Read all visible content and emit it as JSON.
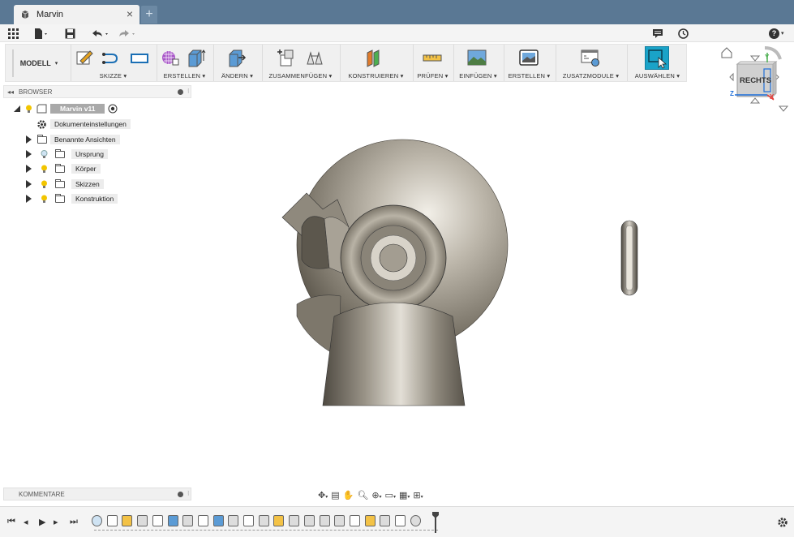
{
  "window": {
    "tab_title": "Marvin",
    "tab_close": "×",
    "new_tab": "+"
  },
  "quick_access": {
    "help": "?"
  },
  "ribbon": {
    "workspace": "MODELL",
    "groups": [
      {
        "name": "SKIZZE",
        "label": "SKIZZE ▾"
      },
      {
        "name": "ERSTELLEN",
        "label": "ERSTELLEN ▾"
      },
      {
        "name": "AENDERN",
        "label": "ÄNDERN ▾"
      },
      {
        "name": "ZUSAMMENFUEGEN",
        "label": "ZUSAMMENFÜGEN ▾"
      },
      {
        "name": "KONSTRUIEREN",
        "label": "KONSTRUIEREN ▾"
      },
      {
        "name": "PRUEFEN",
        "label": "PRÜFEN ▾"
      },
      {
        "name": "EINFUEGEN",
        "label": "EINFÜGEN ▾"
      },
      {
        "name": "ERSTELLEN2",
        "label": "ERSTELLEN ▾"
      },
      {
        "name": "ZUSATZMODULE",
        "label": "ZUSATZMODULE ▾"
      },
      {
        "name": "AUSWAEHLEN",
        "label": "AUSWÄHLEN ▾"
      }
    ]
  },
  "browser": {
    "title": "BROWSER",
    "root": "Marvin v11",
    "items": [
      {
        "label": "Dokumenteinstellungen"
      },
      {
        "label": "Benannte Ansichten"
      },
      {
        "label": "Ursprung"
      },
      {
        "label": "Körper"
      },
      {
        "label": "Skizzen"
      },
      {
        "label": "Konstruktion"
      }
    ]
  },
  "comments": {
    "title": "KOMMENTARE"
  },
  "viewcube": {
    "face": "RECHTS",
    "axis_y": "Y",
    "axis_z": "Z",
    "axis_x": "X"
  },
  "colors": {
    "titlebar": "#5a7894",
    "accent_select": "#1aa3c8",
    "model_metal": "#8a8478"
  }
}
